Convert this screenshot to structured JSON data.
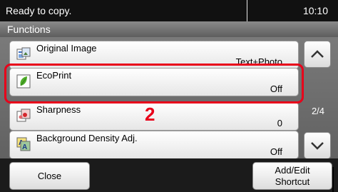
{
  "status": {
    "message": "Ready to copy.",
    "time": "10:10"
  },
  "title": "Functions",
  "items": [
    {
      "label": "Original Image",
      "value": "Text+Photo",
      "icon": "original-image-icon"
    },
    {
      "label": "EcoPrint",
      "value": "Off",
      "icon": "ecoprint-leaf-icon"
    },
    {
      "label": "Sharpness",
      "value": "0",
      "icon": "sharpness-icon"
    },
    {
      "label": "Background Density Adj.",
      "value": "Off",
      "icon": "background-density-icon"
    }
  ],
  "page_indicator": "2/4",
  "callout": "2",
  "buttons": {
    "close": "Close",
    "add_edit_line1": "Add/Edit",
    "add_edit_line2": "Shortcut"
  },
  "colors": {
    "highlight": "#e8001a",
    "status_bar": "#111111"
  }
}
